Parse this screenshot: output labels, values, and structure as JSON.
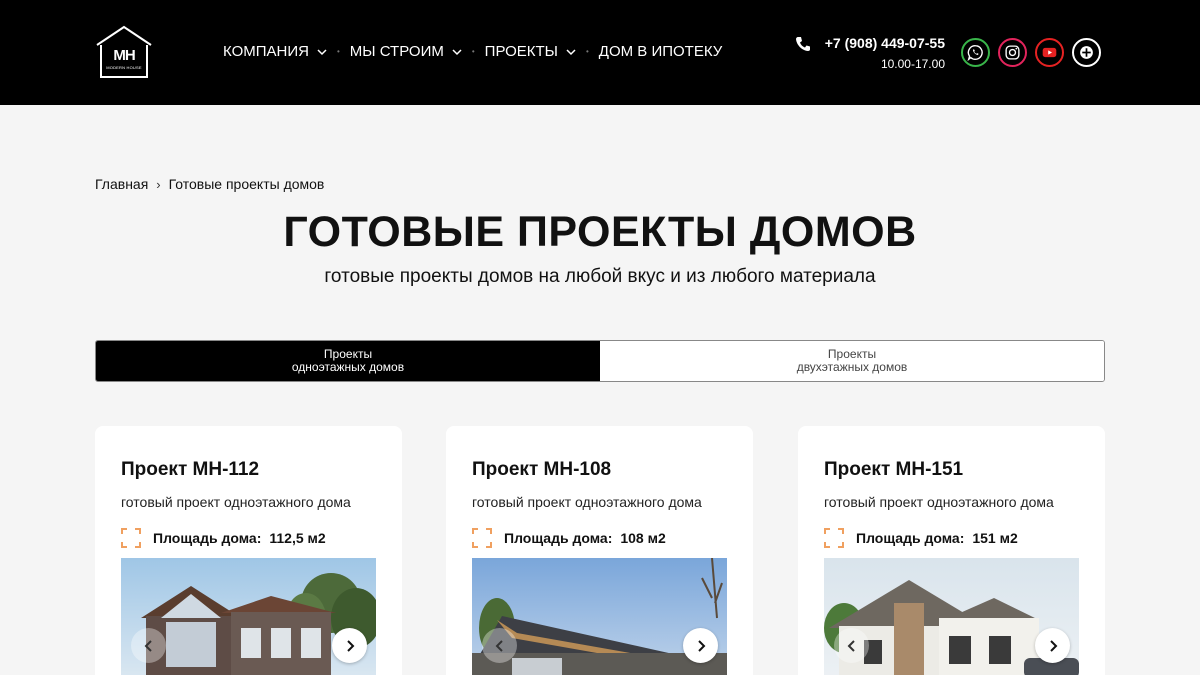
{
  "header": {
    "logo": {
      "monogram": "MH",
      "tagline": "MODERN HOUSE"
    },
    "nav": [
      {
        "label": "КОМПАНИЯ",
        "has_dropdown": true
      },
      {
        "label": "МЫ СТРОИМ",
        "has_dropdown": true
      },
      {
        "label": "ПРОЕКТЫ",
        "has_dropdown": true
      },
      {
        "label": "ДОМ В ИПОТЕКУ",
        "has_dropdown": false
      }
    ],
    "phone": "+7 (908) 449-07-55",
    "hours": "10.00-17.00",
    "social": [
      {
        "name": "whatsapp-icon",
        "color": "#39b54a"
      },
      {
        "name": "instagram-icon",
        "color": "#e2245c"
      },
      {
        "name": "youtube-icon",
        "color": "#e52222"
      },
      {
        "name": "plus-icon",
        "color": "#ffffff"
      }
    ]
  },
  "breadcrumb": {
    "home": "Главная",
    "separator": "›",
    "current": "Готовые проекты домов"
  },
  "page": {
    "title": "ГОТОВЫЕ ПРОЕКТЫ ДОМОВ",
    "subtitle": "готовые проекты домов на любой вкус и из любого материала"
  },
  "tabs": [
    {
      "line1": "Проекты",
      "line2": "одноэтажных домов",
      "active": true
    },
    {
      "line1": "Проекты",
      "line2": "двухэтажных домов",
      "active": false
    }
  ],
  "cards": [
    {
      "title": "Проект МН-112",
      "description": "готовый проект одноэтажного дома",
      "area_label": "Площадь дома:",
      "area_value": "112,5 м2"
    },
    {
      "title": "Проект МН-108",
      "description": "готовый проект одноэтажного дома",
      "area_label": "Площадь дома:",
      "area_value": "108 м2"
    },
    {
      "title": "Проект МН-151",
      "description": "готовый проект одноэтажного дома",
      "area_label": "Площадь дома:",
      "area_value": "151 м2"
    }
  ],
  "colors": {
    "header_bg": "#000000",
    "page_bg": "#f5f5f5",
    "accent_orange": "#f0a060"
  }
}
